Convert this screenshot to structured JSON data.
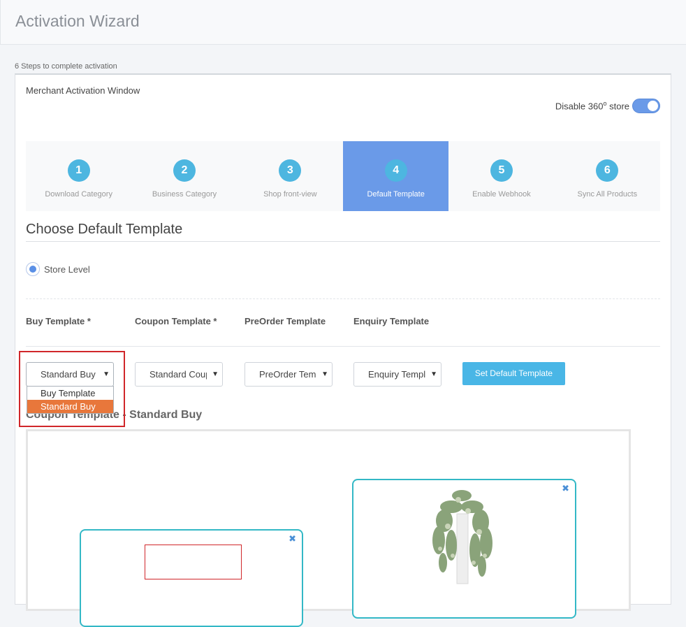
{
  "header": {
    "title": "Activation Wizard"
  },
  "wizard": {
    "steps_caption": "6 Steps to complete activation",
    "card_title": "Merchant Activation Window",
    "toggle": {
      "label_prefix": "Disable 360",
      "label_sup": "o",
      "label_suffix": " store",
      "state": "on"
    },
    "steps": [
      {
        "num": "1",
        "label": "Download Category"
      },
      {
        "num": "2",
        "label": "Business Category"
      },
      {
        "num": "3",
        "label": "Shop front-view"
      },
      {
        "num": "4",
        "label": "Default Template"
      },
      {
        "num": "5",
        "label": "Enable Webhook"
      },
      {
        "num": "6",
        "label": "Sync All Products"
      }
    ],
    "active_step": 4
  },
  "template_section": {
    "title": "Choose Default Template",
    "radio_label": "Store Level",
    "columns": {
      "buy": "Buy Template *",
      "coupon": "Coupon Template *",
      "preorder": "PreOrder Template",
      "enquiry": "Enquiry Template"
    },
    "selects": {
      "buy": "Standard Buy",
      "coupon": "Standard Coupon",
      "preorder": "PreOrder Template",
      "enquiry": "Enquiry Template"
    },
    "dropdown_options": [
      "Buy Template",
      "Standard Buy"
    ],
    "dropdown_selected": "Standard Buy",
    "set_button": "Set Default Template",
    "preview_heading": "Coupon Template",
    "preview_separator": "-",
    "preview_value": "Standard Buy",
    "close_glyph": "✖"
  },
  "colors": {
    "accent": "#6a9ae8",
    "step_badge": "#4db6e0",
    "button": "#49b6e6",
    "selected_option": "#e8773b",
    "highlight": "#d0262a"
  }
}
